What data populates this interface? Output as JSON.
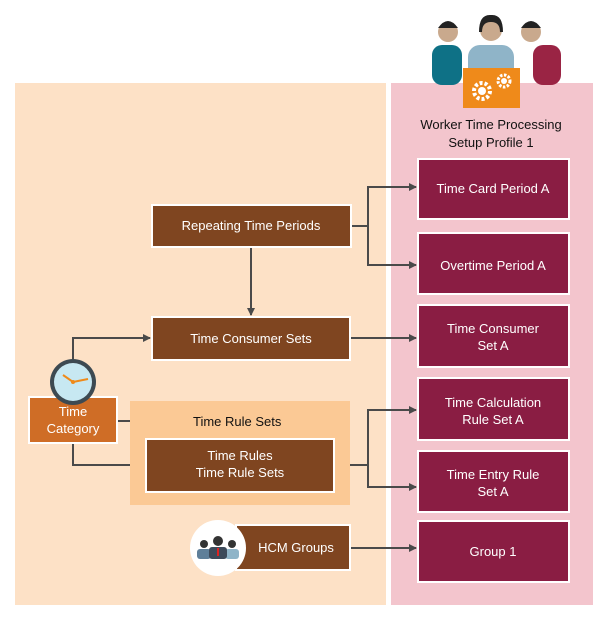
{
  "profile": {
    "title_line1": "Worker Time Processing",
    "title_line2": "Setup Profile 1"
  },
  "left": {
    "repeating_time_periods": "Repeating Time Periods",
    "time_consumer_sets": "Time Consumer Sets",
    "time_category": [
      "Time",
      "Category"
    ],
    "time_rule_sets_label": "Time Rule Sets",
    "time_rules_box": [
      "Time Rules",
      "Time Rule Sets"
    ],
    "hcm_groups": "HCM Groups"
  },
  "right": {
    "boxes": [
      [
        "Time Card Period A"
      ],
      [
        "Overtime Period A"
      ],
      [
        "Time Consumer",
        "Set A"
      ],
      [
        "Time Calculation",
        "Rule Set A"
      ],
      [
        "Time Entry Rule",
        "Set A"
      ],
      [
        "Group 1"
      ]
    ]
  },
  "colors": {
    "left_panel": "#fde1c6",
    "right_panel": "#f3c5cd",
    "brown_box": "#7f4520",
    "maroon_box": "#8a1d43",
    "category_box": "#cf6d26",
    "rule_group": "#fbc995"
  }
}
